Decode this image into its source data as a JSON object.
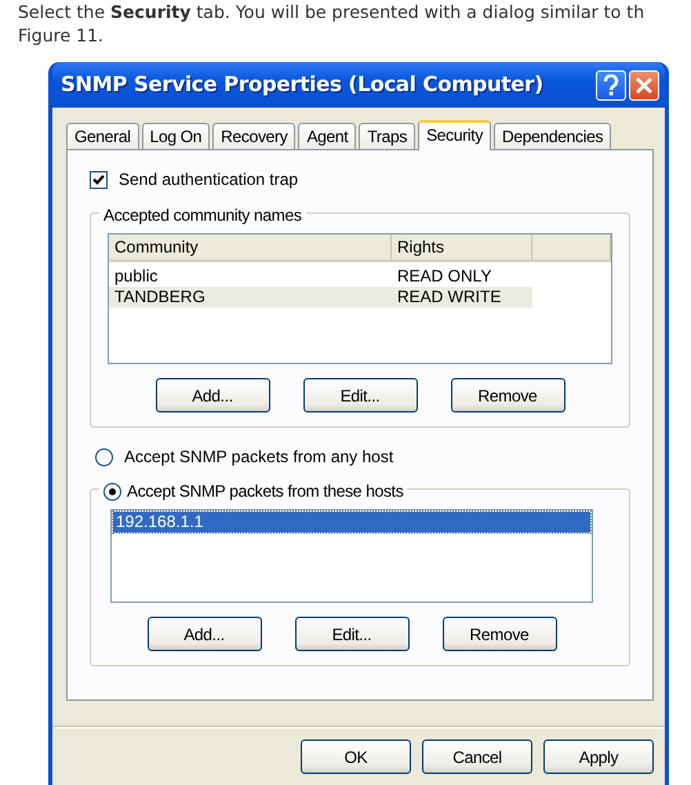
{
  "intro": {
    "lines": [
      "Select the **Security** tab. You will be presented with a dialog similar to th",
      "Figure 11."
    ]
  },
  "window": {
    "title": "SNMP Service Properties (Local Computer)"
  },
  "tabs": [
    {
      "label": "General",
      "selected": false
    },
    {
      "label": "Log On",
      "selected": false
    },
    {
      "label": "Recovery",
      "selected": false
    },
    {
      "label": "Agent",
      "selected": false
    },
    {
      "label": "Traps",
      "selected": false
    },
    {
      "label": "Security",
      "selected": true
    },
    {
      "label": "Dependencies",
      "selected": false
    }
  ],
  "send_authentication_trap": {
    "label": "Send authentication trap",
    "checked": true
  },
  "community_group": {
    "title": "Accepted community names",
    "columns": [
      "Community",
      "Rights"
    ],
    "rows": [
      {
        "cells": [
          "public",
          "READ ONLY"
        ],
        "selected": false
      },
      {
        "cells": [
          "TANDBERG",
          "READ WRITE"
        ],
        "selected": true
      }
    ],
    "buttons": [
      "Add...",
      "Edit...",
      "Remove"
    ]
  },
  "host_options": [
    {
      "label": "Accept SNMP packets from any host",
      "selected": false
    },
    {
      "label": "Accept SNMP packets from these hosts",
      "selected": true
    }
  ],
  "hosts": {
    "items": [
      {
        "text": "192.168.1.1",
        "selected": true
      }
    ],
    "buttons": [
      "Add...",
      "Edit...",
      "Remove"
    ]
  },
  "dialog_buttons": [
    "OK",
    "Cancel",
    "Apply"
  ]
}
